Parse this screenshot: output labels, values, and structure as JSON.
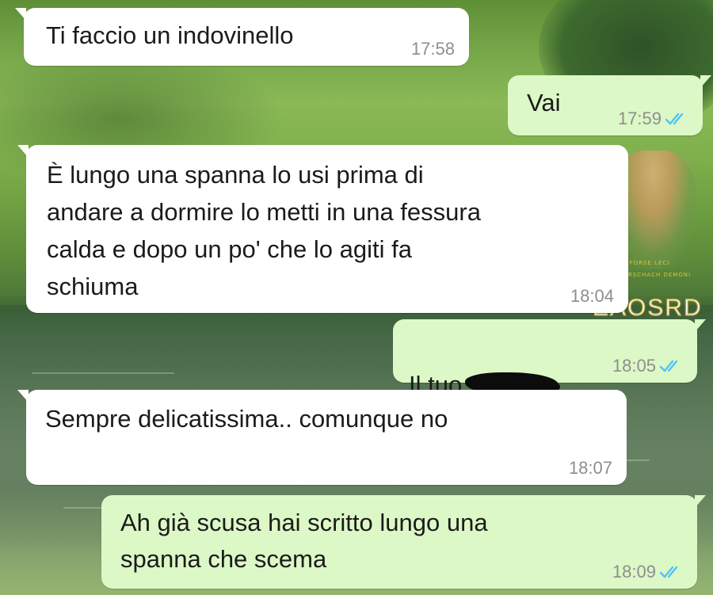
{
  "chat": {
    "messages": [
      {
        "direction": "incoming",
        "text": "Ti faccio un indovinello",
        "time": "17:58"
      },
      {
        "direction": "outgoing",
        "text": "Vai",
        "time": "17:59",
        "status": "read"
      },
      {
        "direction": "incoming",
        "text": "È lungo una spanna lo usi prima di\nandare a dormire lo metti in una fessura\ncalda e dopo un po' che lo agiti fa\nschiuma",
        "time": "18:04"
      },
      {
        "direction": "outgoing",
        "text": "Il tuo",
        "time": "18:05",
        "status": "read",
        "censored": true
      },
      {
        "direction": "incoming",
        "text": "Sempre delicatissima.. comunque no",
        "time": "18:07"
      },
      {
        "direction": "outgoing",
        "text": "Ah già scusa hai scritto lungo una\nspanna che scema",
        "time": "18:09",
        "status": "read"
      }
    ]
  },
  "watermark": {
    "brand_top": "FORSE LECI",
    "brand_bottom": "DI RORSCHACH DEMONI",
    "logo": "EAOSRD"
  },
  "colors": {
    "incoming_bubble": "#ffffff",
    "outgoing_bubble": "#dcf8c6",
    "read_ticks": "#4fc3f7",
    "timestamp": "#8e8e8e"
  },
  "icons": {
    "read_receipt": "double-check-icon"
  }
}
